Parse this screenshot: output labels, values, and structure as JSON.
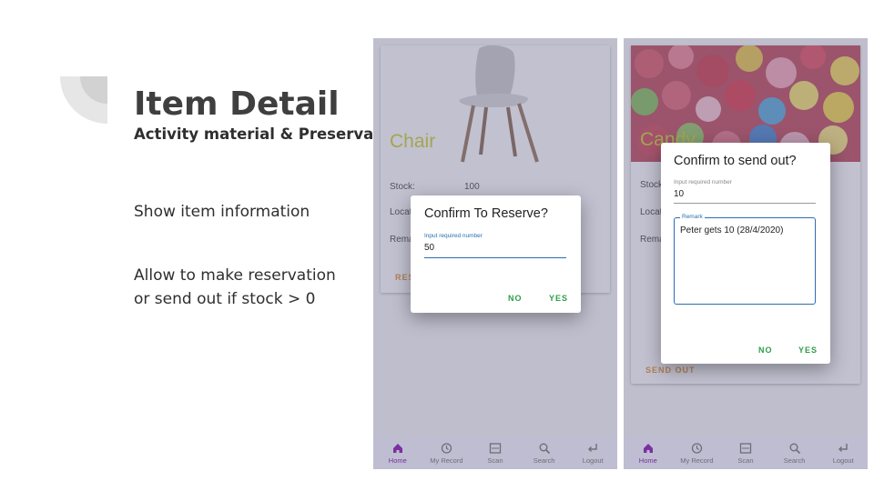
{
  "slide": {
    "title": "Item Detail",
    "subtitle": "Activity material & Preservation",
    "bullet1": "Show item information",
    "bullet2_line1": "Allow to make reservation",
    "bullet2_line2": "or send out if stock > 0"
  },
  "phone1": {
    "item_name": "Chair",
    "stock_label": "Stock:",
    "stock_value": "100",
    "location_label": "Locat",
    "remark_label": "Rema",
    "action_label": "RES",
    "dialog": {
      "title": "Confirm To Reserve?",
      "field_label": "Input required number",
      "field_value": "50",
      "no": "NO",
      "yes": "YES"
    }
  },
  "phone2": {
    "item_name": "Candy",
    "stock_label": "Stock",
    "location_label": "Locat",
    "remark_label": "Rema",
    "action_label": "SEND OUT",
    "dialog": {
      "title": "Confirm to send out?",
      "field_label": "Input required number",
      "field_value": "10",
      "remark_label": "Remark",
      "remark_value": "Peter gets 10 (28/4/2020)",
      "no": "NO",
      "yes": "YES"
    }
  },
  "nav": [
    {
      "label": "Home",
      "icon": "home-icon"
    },
    {
      "label": "My Record",
      "icon": "history-icon"
    },
    {
      "label": "Scan",
      "icon": "scan-icon"
    },
    {
      "label": "Search",
      "icon": "search-icon"
    },
    {
      "label": "Logout",
      "icon": "logout-icon"
    }
  ],
  "colors": {
    "accent_green": "#2e9d4a",
    "field_blue": "#2a6fb0",
    "item_name_yellow": "#c6cc1a",
    "nav_active": "#7b2fa0"
  }
}
